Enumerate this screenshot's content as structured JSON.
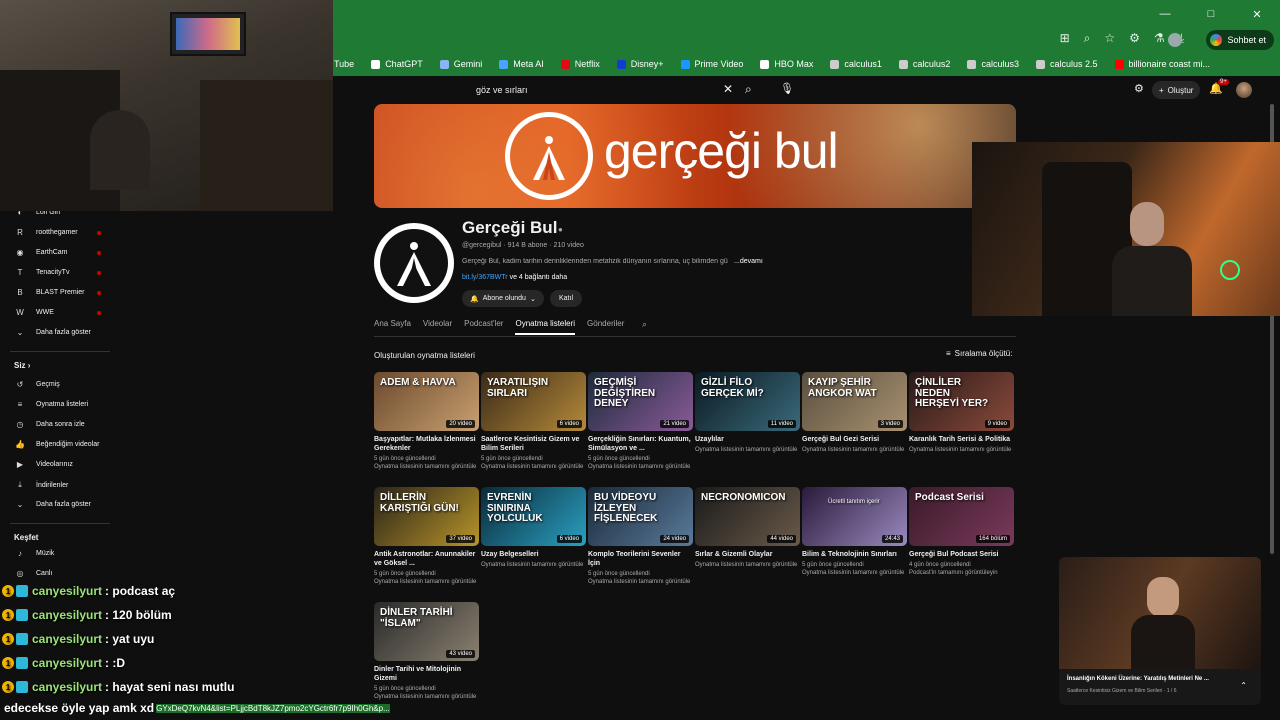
{
  "window": {
    "minimize": "—",
    "maximize": "□",
    "close": "✕"
  },
  "browser": {
    "chat_label": "Sohbet et"
  },
  "bookmarks": [
    {
      "label": "Tube",
      "color": "#ff0000"
    },
    {
      "label": "ChatGPT",
      "color": "#ffffff"
    },
    {
      "label": "Gemini",
      "color": "#8ab4f8"
    },
    {
      "label": "Meta AI",
      "color": "#4aa3ff"
    },
    {
      "label": "Netflix",
      "color": "#e50914"
    },
    {
      "label": "Disney+",
      "color": "#113ccf"
    },
    {
      "label": "Prime Video",
      "color": "#1a98ff"
    },
    {
      "label": "HBO Max",
      "color": "#ffffff"
    },
    {
      "label": "calculus1",
      "color": "#cccccc"
    },
    {
      "label": "calculus2",
      "color": "#cccccc"
    },
    {
      "label": "calculus3",
      "color": "#cccccc"
    },
    {
      "label": "calculus 2.5",
      "color": "#cccccc"
    },
    {
      "label": "billionaire coast mi...",
      "color": "#ff0000"
    }
  ],
  "search": {
    "query": "göz ve sırları"
  },
  "header": {
    "create_label": "Oluştur",
    "notif_count": "9+"
  },
  "banner": {
    "title": "gerçeği bul"
  },
  "channel": {
    "name": "Gerçeği Bul",
    "meta": "@gercegibul · 914 B abone · 210 video",
    "description": "Gerçeği Bul, kadim tarihin derinliklerinden metafizik dünyanın sırlarına, uç bilimden gü",
    "more": "...devamı",
    "link": "bit.ly/367BWTr",
    "link_more": " ve 4 bağlantı daha",
    "subscribe_label": "Abone olundu",
    "join_label": "Katıl"
  },
  "tabs": [
    "Ana Sayfa",
    "Videolar",
    "Podcast'ler",
    "Oynatma listeleri",
    "Gönderiler"
  ],
  "section": {
    "title": "Oluşturulan oynatma listeleri",
    "sort_label": "Sıralama ölçütü:"
  },
  "playlists": [
    {
      "thumb_text": "ADEM & HAVVA",
      "count": "20 video",
      "title": "Başyapıtlar: Mutlaka İzlenmesi Gerekenler",
      "sub1": "5 gün önce güncellendi",
      "sub2": "Oynatma listesinin tamamını görüntüle",
      "c1": "#6b4a2e",
      "c2": "#c9a070"
    },
    {
      "thumb_text": "YARATILIŞIN SIRLARI",
      "count": "6 video",
      "title": "Saatlerce Kesintisiz Gizem ve Bilim Serileri",
      "sub1": "5 gün önce güncellendi",
      "sub2": "Oynatma listesinin tamamını görüntüle",
      "c1": "#3a2a18",
      "c2": "#b58a3a"
    },
    {
      "thumb_text": "GEÇMİŞİ DEĞİŞTİREN DENEY",
      "count": "21 video",
      "title": "Gerçekliğin Sınırları: Kuantum, Simülasyon ve ...",
      "sub1": "5 gün önce güncellendi",
      "sub2": "Oynatma listesinin tamamını görüntüle",
      "c1": "#1d2b3a",
      "c2": "#8a5a9a"
    },
    {
      "thumb_text": "GİZLİ FİLO GERÇEK Mİ?",
      "count": "11 video",
      "title": "Uzaylılar",
      "sub1": "",
      "sub2": "Oynatma listesinin tamamını görüntüle",
      "c1": "#0b1a22",
      "c2": "#3a6a7a"
    },
    {
      "thumb_text": "KAYIP ŞEHİR ANGKOR WAT",
      "count": "3 video",
      "title": "Gerçeği Bul Gezi Serisi",
      "sub1": "",
      "sub2": "Oynatma listesinin tamamını görüntüle",
      "c1": "#5a5040",
      "c2": "#a89070"
    },
    {
      "thumb_text": "ÇİNLİLER NEDEN HERŞEYİ YER?",
      "count": "9 video",
      "title": "Karanlık Tarih Serisi & Politika",
      "sub1": "",
      "sub2": "Oynatma listesinin tamamını görüntüle",
      "c1": "#2a1a1a",
      "c2": "#8a4a3a"
    },
    {
      "thumb_text": "DİLLERİN KARIŞTIĞI GÜN!",
      "count": "37 video",
      "title": "Antik Astronotlar: Anunnakiler ve Göksel ...",
      "sub1": "5 gün önce güncellendi",
      "sub2": "Oynatma listesinin tamamını görüntüle",
      "c1": "#2a2418",
      "c2": "#b8942a"
    },
    {
      "thumb_text": "EVRENİN SINIRINA YOLCULUK",
      "count": "6 video",
      "title": "Uzay Belgeselleri",
      "sub1": "",
      "sub2": "Oynatma listesinin tamamını görüntüle",
      "c1": "#0a2a3a",
      "c2": "#2aa0c0"
    },
    {
      "thumb_text": "BU VİDEOYU İZLEYEN FİŞLENECEK",
      "count": "24 video",
      "title": "Komplo Teorilerini Sevenler İçin",
      "sub1": "5 gün önce güncellendi",
      "sub2": "Oynatma listesinin tamamını görüntüle",
      "c1": "#1a2a3a",
      "c2": "#5a7a9a"
    },
    {
      "thumb_text": "NECRONOMICON",
      "count": "44 video",
      "title": "Sırlar & Gizemli Olaylar",
      "sub1": "",
      "sub2": "Oynatma listesinin tamamını görüntüle",
      "c1": "#1a1a1a",
      "c2": "#6a5a4a"
    },
    {
      "thumb_text": "Ücretli tanıtım içerir",
      "count": "24:43",
      "title": "Bilim & Teknolojinin Sınırları",
      "sub1": "5 gün önce güncellendi",
      "sub2": "Oynatma listesinin tamamını görüntüle",
      "c1": "#2a1a3a",
      "c2": "#9a8ac0"
    },
    {
      "thumb_text": "Podcast Serisi",
      "count": "164 bölüm",
      "title": "Gerçeği Bul Podcast Serisi",
      "sub1": "4 gün önce güncellendi",
      "sub2": "Podcast'in tamamını görüntüleyin",
      "c1": "#3a1a2a",
      "c2": "#7a3a5a"
    },
    {
      "thumb_text": "DİNLER TARİHİ \"İSLAM\"",
      "count": "43 video",
      "title": "Dinler Tarihi ve Mitolojinin Gizemi",
      "sub1": "5 gün önce güncellendi",
      "sub2": "Oynatma listesinin tamamını görüntüle",
      "c1": "#2a2a2a",
      "c2": "#8a8070"
    }
  ],
  "sidebar": {
    "subs": [
      {
        "label": "Lofi Girl",
        "icon": "◐"
      },
      {
        "label": "rootthegamer",
        "icon": "R"
      },
      {
        "label": "EarthCam",
        "icon": "◉"
      },
      {
        "label": "TenacityTv",
        "icon": "T"
      },
      {
        "label": "BLAST Premier",
        "icon": "B"
      },
      {
        "label": "WWE",
        "icon": "W"
      },
      {
        "label": "Daha fazla göster",
        "icon": "⌄"
      }
    ],
    "you_header": "Siz",
    "you": [
      {
        "label": "Geçmiş",
        "icon": "↺"
      },
      {
        "label": "Oynatma listeleri",
        "icon": "≡"
      },
      {
        "label": "Daha sonra izle",
        "icon": "◷"
      },
      {
        "label": "Beğendiğim videolar",
        "icon": "👍"
      },
      {
        "label": "Videolarınız",
        "icon": "▶"
      },
      {
        "label": "İndirilenler",
        "icon": "⤓"
      },
      {
        "label": "Daha fazla göster",
        "icon": "⌄"
      }
    ],
    "explore_header": "Keşfet",
    "explore": [
      {
        "label": "Müzik",
        "icon": "♪"
      },
      {
        "label": "Canlı",
        "icon": "◎"
      }
    ]
  },
  "chat": [
    {
      "user": "canyesilyurt",
      "msg": ": podcast aç"
    },
    {
      "user": "canyesilyurt",
      "msg": ": 120 bölüm"
    },
    {
      "user": "canyesilyurt",
      "msg": ": yat uyu"
    },
    {
      "user": "canyesilyurt",
      "msg": ": :D"
    },
    {
      "user": "canyesilyurt",
      "msg": ": hayat seni nası mutlu"
    }
  ],
  "url_line": {
    "lead": "edecekse öyle yap amk xd",
    "url": "GYxDeQ7kvN4&list=PLjjcBdT8kJZ7pmo2cYGctr6fr7p9Ih0Gh&p..."
  },
  "pip": {
    "title": "İnsanlığın Kökeni Üzerine: Yaratılış Metinleri Ne ...",
    "sub": "Saatlerce Kesintisiz Gizem ve Bilim Serileri · 1 / 6"
  }
}
